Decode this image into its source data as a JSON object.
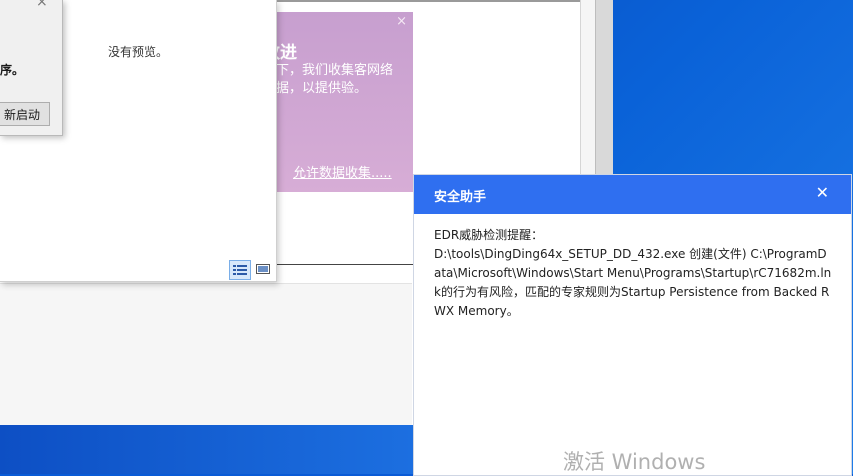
{
  "preview": {
    "no_preview_text": "没有预览。"
  },
  "dialog": {
    "close_glyph": "×",
    "message_fragment": "序。",
    "restart_label": "新启动"
  },
  "purple_card": {
    "title": "改进",
    "body": "况下，我们收集客网络数据，以提供验。",
    "link": "允许数据收集.....",
    "close_glyph": "×"
  },
  "popup": {
    "title": "安全助手",
    "close_glyph": "✕",
    "heading": "EDR威胁检测提醒：",
    "message": " D:\\tools\\DingDing64x_SETUP_DD_432.exe 创建(文件) C:\\ProgramData\\Microsoft\\Windows\\Start Menu\\Programs\\Startup\\rC71682m.lnk的行为有风险，匹配的专家规则为Startup Persistence from Backed RWX Memory。"
  },
  "watermark": "激活 Windows",
  "colors": {
    "popup_header": "#2f6ff0",
    "purple_banner": "#c79fcf",
    "desktop": "#0a5bd6"
  }
}
